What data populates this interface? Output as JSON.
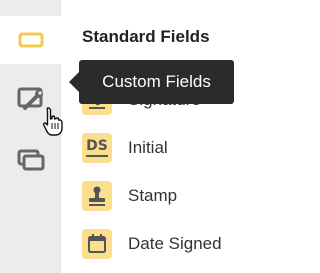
{
  "colors": {
    "accent_yellow": "#fbdf8e",
    "icon_gray": "#666666",
    "rail_bg": "#ececec",
    "tooltip_bg": "#2b2b2b"
  },
  "rail": {
    "items": [
      {
        "icon": "field-box-icon",
        "selected": true
      },
      {
        "icon": "custom-fields-icon",
        "selected": false
      },
      {
        "icon": "stacked-windows-icon",
        "selected": false
      }
    ]
  },
  "panel": {
    "title": "Standard Fields",
    "fields": [
      {
        "label": "Signature",
        "icon": "signature-icon"
      },
      {
        "label": "Initial",
        "icon": "initial-icon",
        "icon_text": "DS"
      },
      {
        "label": "Stamp",
        "icon": "stamp-icon"
      },
      {
        "label": "Date Signed",
        "icon": "calendar-icon"
      }
    ]
  },
  "tooltip": {
    "text": "Custom Fields"
  },
  "cursor": {
    "icon": "hand-pointer-icon"
  }
}
